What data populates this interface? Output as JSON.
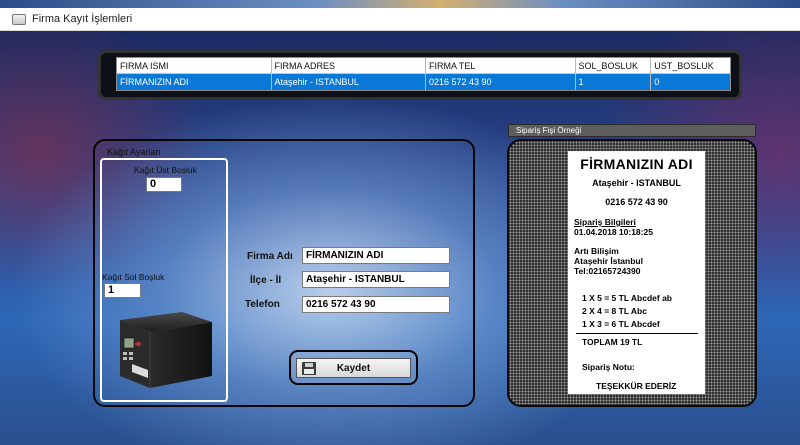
{
  "window": {
    "title": "Firma Kayıt İşlemleri"
  },
  "grid": {
    "columns": [
      "FIRMA ISMI",
      "FIRMA ADRES",
      "FIRMA TEL",
      "SOL_BOSLUK",
      "UST_BOSLUK"
    ],
    "rows": [
      [
        "FİRMANIZIN ADI",
        "Ataşehir - ISTANBUL",
        "0216 572 43 90",
        "1",
        "0"
      ]
    ]
  },
  "paper_settings": {
    "group_title": "Kağıt Ayarları",
    "top_margin_label": "Kağıt Üst Boşluk",
    "top_margin_value": "0",
    "left_margin_label": "Kağıt Sol Boşluk",
    "left_margin_value": "1"
  },
  "form": {
    "company_name_label": "Firma Adı",
    "company_name_value": "FİRMANIZIN ADI",
    "district_label": "İlçe - İl",
    "district_value": "Ataşehir - ISTANBUL",
    "phone_label": "Telefon",
    "phone_value": "0216 572 43 90",
    "save_label": "Kaydet"
  },
  "receipt": {
    "panel_title": "Sipariş Fişi Örneği",
    "company": "FİRMANIZIN ADI",
    "district": "Ataşehir - ISTANBUL",
    "phone": "0216 572 43 90",
    "order_info_label": "Sipariş Bilgileri",
    "order_datetime": "01.04.2018 10:18:25",
    "customer_name": "Artı Bilişim",
    "customer_address": "Ataşehir İstanbul",
    "customer_phone": "Tel:02165724390",
    "items": [
      "1 X 5 = 5 TL Abcdef ab",
      "2 X 4 = 8 TL Abc",
      "1 X 3 = 6 TL Abcdef"
    ],
    "total": "TOPLAM   19 TL",
    "note_label": "Sipariş Notu:",
    "thanks": "TEŞEKKÜR EDERİZ"
  }
}
